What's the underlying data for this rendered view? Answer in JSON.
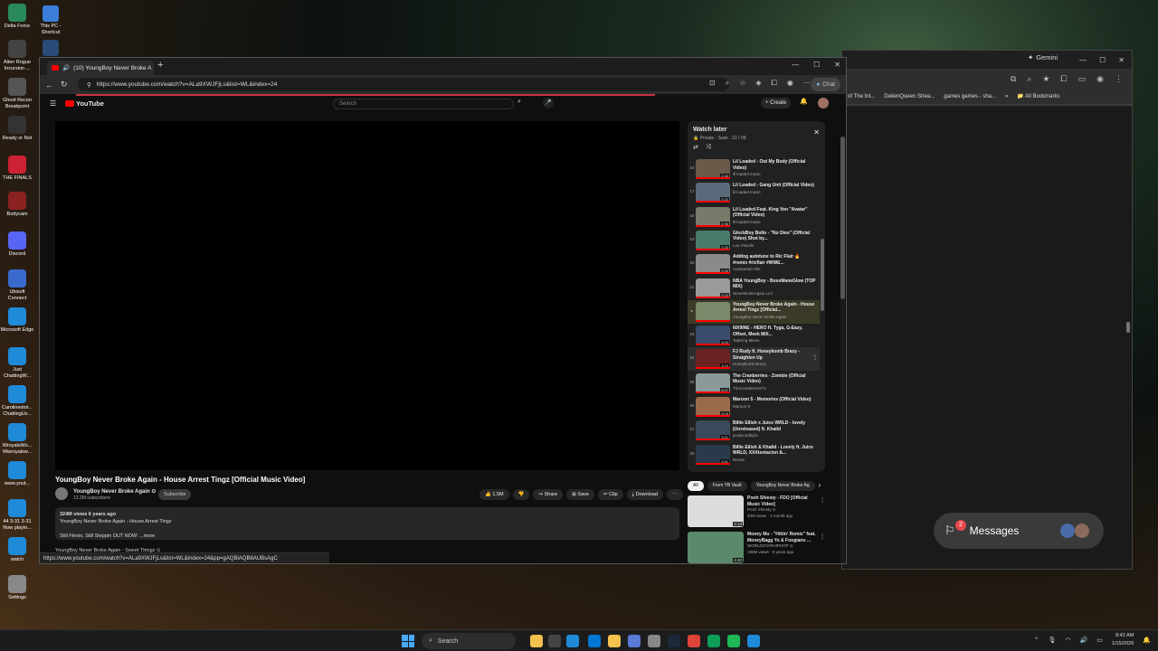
{
  "desktop_icons": [
    {
      "label": "Delta Force",
      "color": "#2a8a5a"
    },
    {
      "label": "Alien Rogue Incursion ...",
      "color": "#444"
    },
    {
      "label": "Ghost Recon Breakpoint",
      "color": "#555"
    },
    {
      "label": "Ready or Not",
      "color": "#333"
    },
    {
      "label": "THE FINALS",
      "color": "#cc2233"
    },
    {
      "label": "Bodycam",
      "color": "#8a2222"
    },
    {
      "label": "Discord",
      "color": "#5865f2"
    },
    {
      "label": "Ubisoft Connect",
      "color": "#3a6acc"
    },
    {
      "label": "Microsoft Edge",
      "color": "#1f8ad8"
    },
    {
      "label": "Just ChattingW...",
      "color": "#1f8ad8"
    },
    {
      "label": "Carolinestor... ChattingUv...",
      "color": "#1f8ad8"
    },
    {
      "label": "WroyalsWo... Wwroyalsw...",
      "color": "#1f8ad8"
    },
    {
      "label": "www.yout...",
      "color": "#1f8ad8"
    },
    {
      "label": "44 3-31 3-31 Now playin...",
      "color": "#1f8ad8"
    },
    {
      "label": "watch",
      "color": "#1f8ad8"
    },
    {
      "label": "Settings",
      "color": "#888"
    }
  ],
  "desktop_icons2": [
    {
      "label": "This PC - Shortcut",
      "color": "#3b7dd8"
    },
    {
      "label": "",
      "color": "#2a4a7a"
    }
  ],
  "bg_window": {
    "gemini_label": "Gemini",
    "bookmarks": [
      "of The Int...",
      "DeilenQueen Strea...",
      "games games - sha..."
    ],
    "all_bookmarks": "All Bookmarks"
  },
  "messages": {
    "label": "Messages",
    "badge": "2"
  },
  "main_window": {
    "tab_title": "(10) YoungBoy Never Broke A",
    "url": "https://www.youtube.com/watch?v=ALa9XWJFjLs&list=WL&index=24",
    "chat_label": "Chat"
  },
  "youtube": {
    "logo": "YouTube",
    "search_placeholder": "Search",
    "create_label": "+ Create",
    "video_title": "YoungBoy Never Broke Again - House Arrest Tingz [Official Music Video]",
    "channel_name": "YoungBoy Never Broke Again ⊙",
    "channel_subs": "13.2M subscribers",
    "subscribe_label": "Subscribe",
    "actions": [
      "👍 1.5M",
      "👎",
      "↪ Share",
      "⊞ Save",
      "✂ Clip",
      "⤓ Download",
      "⋯"
    ],
    "desc_line1": "324M views 6 years ago",
    "desc_line2": "YoungBoy Never Broke Again - House Arrest Tingz",
    "desc_line3": "Still Flexin, Still Steppin OUT NOW: ...more",
    "next_title": "YoungBoy Never Broke Again - Sweet Thingz ⊙",
    "status_url": "https://www.youtube.com/watch?v=ALa9XWJFjLs&list=WL&index=24&pp=gAQBiAQB8AUBsAgC"
  },
  "playlist": {
    "title": "Watch later",
    "subtitle": "🔒 Private · Sask · 22 / 98",
    "items": [
      {
        "idx": "16",
        "title": "Lil Loaded - Out My Body (Official Video)",
        "channel": "lil loaded music",
        "dur": "2:40",
        "color": "#6a5a4a"
      },
      {
        "idx": "17",
        "title": "Lil Loaded - Gang Unit (Official Video)",
        "channel": "lil loaded music",
        "dur": "2:21",
        "color": "#5a6a7a"
      },
      {
        "idx": "18",
        "title": "Lil Loaded Feat. King Von \"Avatar\" (Official Video)",
        "channel": "lil loaded music",
        "dur": "2:36",
        "color": "#7a7a6a"
      },
      {
        "idx": "19",
        "title": "GlockBoy Bollo - \"No Dies\" (Official Video) Shot by...",
        "channel": "Lou Visuals",
        "dur": "2:33",
        "color": "#4a7a6a"
      },
      {
        "idx": "20",
        "title": "Adding autotune to Ric Flair 🔥 #remix #ricflair #WWE...",
        "channel": "Autotuned Vids",
        "dur": "1:00",
        "color": "#8a8a8a"
      },
      {
        "idx": "21",
        "title": "NBA YoungBoy - BossManeGlow (TOP MIX)",
        "channel": "NeverBrokeAgain LLC",
        "dur": "2:22",
        "color": "#9a9a9a"
      },
      {
        "idx": "▸",
        "title": "YoungBoy Never Broke Again - House Arrest Tingz [Official...",
        "channel": "YoungBoy Never Broke Again",
        "dur": "",
        "color": "#7a8a6a"
      },
      {
        "idx": "23",
        "title": "6IX9INE - HERO ft. Tyga, G-Eazy, Offset, Meek Mill...",
        "channel": "TapKing Mixes",
        "dur": "3:03",
        "color": "#3a4a6a"
      },
      {
        "idx": "24",
        "title": "FJ Rudy ft. Honeykomb Brazy - Straighten Up",
        "channel": "Honeykomb Brazy",
        "dur": "3:19",
        "color": "#6a2222"
      },
      {
        "idx": "25",
        "title": "The Cranberries - Zombie (Official Music Video)",
        "channel": "TheCranberriesTV",
        "dur": "5:07",
        "color": "#8a9a9a"
      },
      {
        "idx": "26",
        "title": "Maroon 5 - Memories (Official Video)",
        "channel": "Maroon 5",
        "dur": "3:15",
        "color": "#9a6a4a"
      },
      {
        "idx": "27",
        "title": "Billie Eilish x Juice WRLD - lovely (Unreleased) ft. Khalid",
        "channel": "producedbykx",
        "dur": "3:21",
        "color": "#3a4a5a"
      },
      {
        "idx": "28",
        "title": "Billie Eilish & Khalid - Lovely ft. Juice WRLD, XXXtentacion &...",
        "channel": "Rexne",
        "dur": "3:51",
        "color": "#2a3a4a"
      }
    ]
  },
  "chips": [
    "All",
    "From YB Vault",
    "YoungBoy Never Broke Ag"
  ],
  "recommendations": [
    {
      "title": "Pooh Shiesty - FDO [Official Music Video]",
      "channel": "Pooh Shiesty ⊙",
      "meta": "33M views · 1 month ago",
      "dur": "3:13",
      "color": "#ddd"
    },
    {
      "title": "Money Mu - \"Hittin' Remix\" feat. MoneyBagg Yo & Foogiano ...",
      "channel": "WORLDSTARHIPHOP ⊙",
      "meta": "193M views · 5 years ago",
      "dur": "4:40",
      "color": "#5a8a6a"
    }
  ],
  "taskbar": {
    "search_label": "Search",
    "time": "8:42 AM",
    "date": "1/15/2026"
  }
}
